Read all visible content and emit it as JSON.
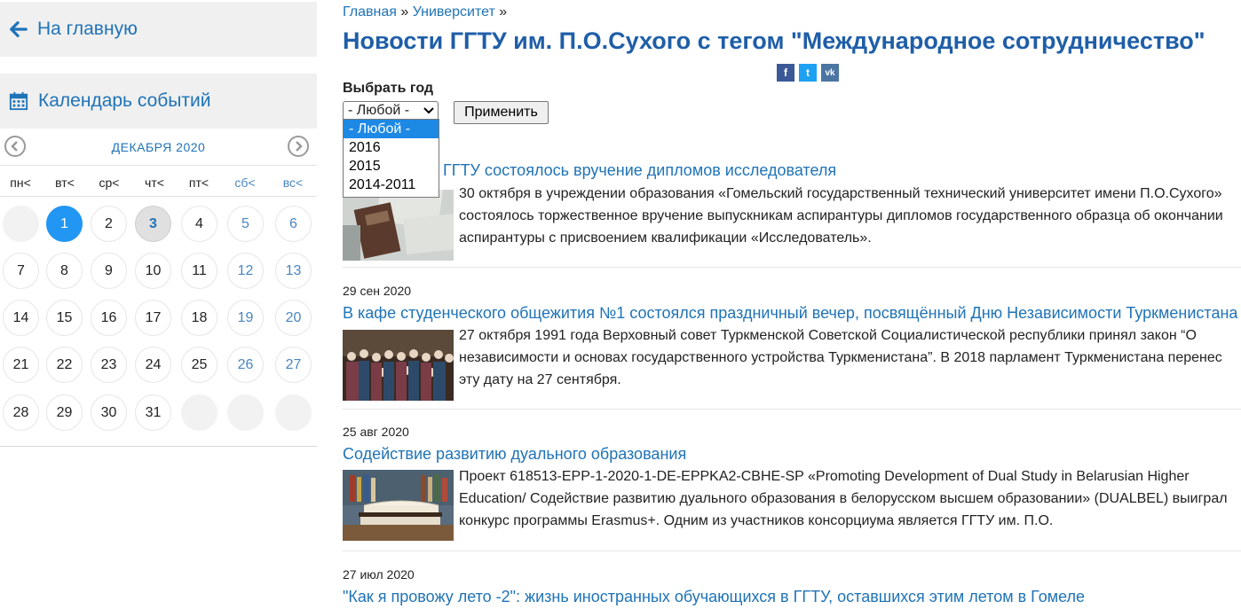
{
  "sidebar": {
    "home_label": "На главную",
    "calendar_title": "Календарь событий",
    "month_label": "ДЕКАБРЯ 2020",
    "weekdays": [
      "пн<",
      "вт<",
      "ср<",
      "чт<",
      "пт<",
      "сб<",
      "вс<"
    ],
    "weeks": [
      [
        "",
        "1",
        "2",
        "3",
        "4",
        "5",
        "6"
      ],
      [
        "7",
        "8",
        "9",
        "10",
        "11",
        "12",
        "13"
      ],
      [
        "14",
        "15",
        "16",
        "17",
        "18",
        "19",
        "20"
      ],
      [
        "21",
        "22",
        "23",
        "24",
        "25",
        "26",
        "27"
      ],
      [
        "28",
        "29",
        "30",
        "31",
        "",
        "",
        ""
      ]
    ],
    "selected_day": "1",
    "today_day": "3"
  },
  "breadcrumb": {
    "home": "Главная",
    "sep1": " » ",
    "university": "Университет",
    "sep2": " »"
  },
  "page_title": "Новости ГГТУ им. П.О.Сухого с тегом \"Международное сотрудничество\"",
  "share": {
    "facebook": "f",
    "twitter": "t",
    "vk": "vk"
  },
  "filter": {
    "label": "Выбрать год",
    "selected": "- Любой -",
    "options": [
      "- Любой -",
      "2016",
      "2015",
      "2014-2011"
    ],
    "apply_label": "Применить"
  },
  "news": [
    {
      "date": "",
      "title": "ГГТУ состоялось вручение дипломов исследователя",
      "text_lines": [
        "   30 октября в учреждении образования «Гомельский государственный технический университет имени П.О.Сухого»",
        "состоялось торжественное вручение выпускникам аспирантуры дипломов государственного образца об окончании",
        "аспирантуры с присвоением квалификации «Исследователь»."
      ]
    },
    {
      "date": "29 сен 2020",
      "title": "В кафе студенческого общежития №1 состоялся праздничный вечер, посвящённый Дню Независимости Туркменистана",
      "text_lines": [
        "27 октября 1991 года Верховный совет Туркменской Советской Социалистической республики принял закон “О",
        "независимости и основах государственного устройства Туркменистана”. В 2018 парламент Туркменистана перенес",
        "эту дату на 27 сентября."
      ]
    },
    {
      "date": "25 авг 2020",
      "title": "Содействие развитию дуального образования",
      "text_lines": [
        "    Проект 618513-EPP-1-2020-1-DE-EPPKA2-CBHE-SP «Promoting Development of Dual Study in Belarusian Higher",
        "Education/ Содействие развитию дуального образования в белорусском  высшем образовании» (DUALBEL) выиграл",
        "конкурс программы Erasmus+. Одним из участников консорциума является ГГТУ им. П.О."
      ]
    },
    {
      "date": "27 июл 2020",
      "title": "\"Как я провожу лето -2\": жизнь иностранных обучающихся в ГГТУ, оставшихся этим летом в Гомеле",
      "text_lines": []
    }
  ],
  "colors": {
    "link": "#1f73b7",
    "title": "#1f5ea8",
    "selected_day": "#2196f3",
    "panel_bg": "#f0f0f0",
    "facebook": "#3b5998",
    "twitter": "#1da1f2",
    "vk": "#4c75a3"
  }
}
